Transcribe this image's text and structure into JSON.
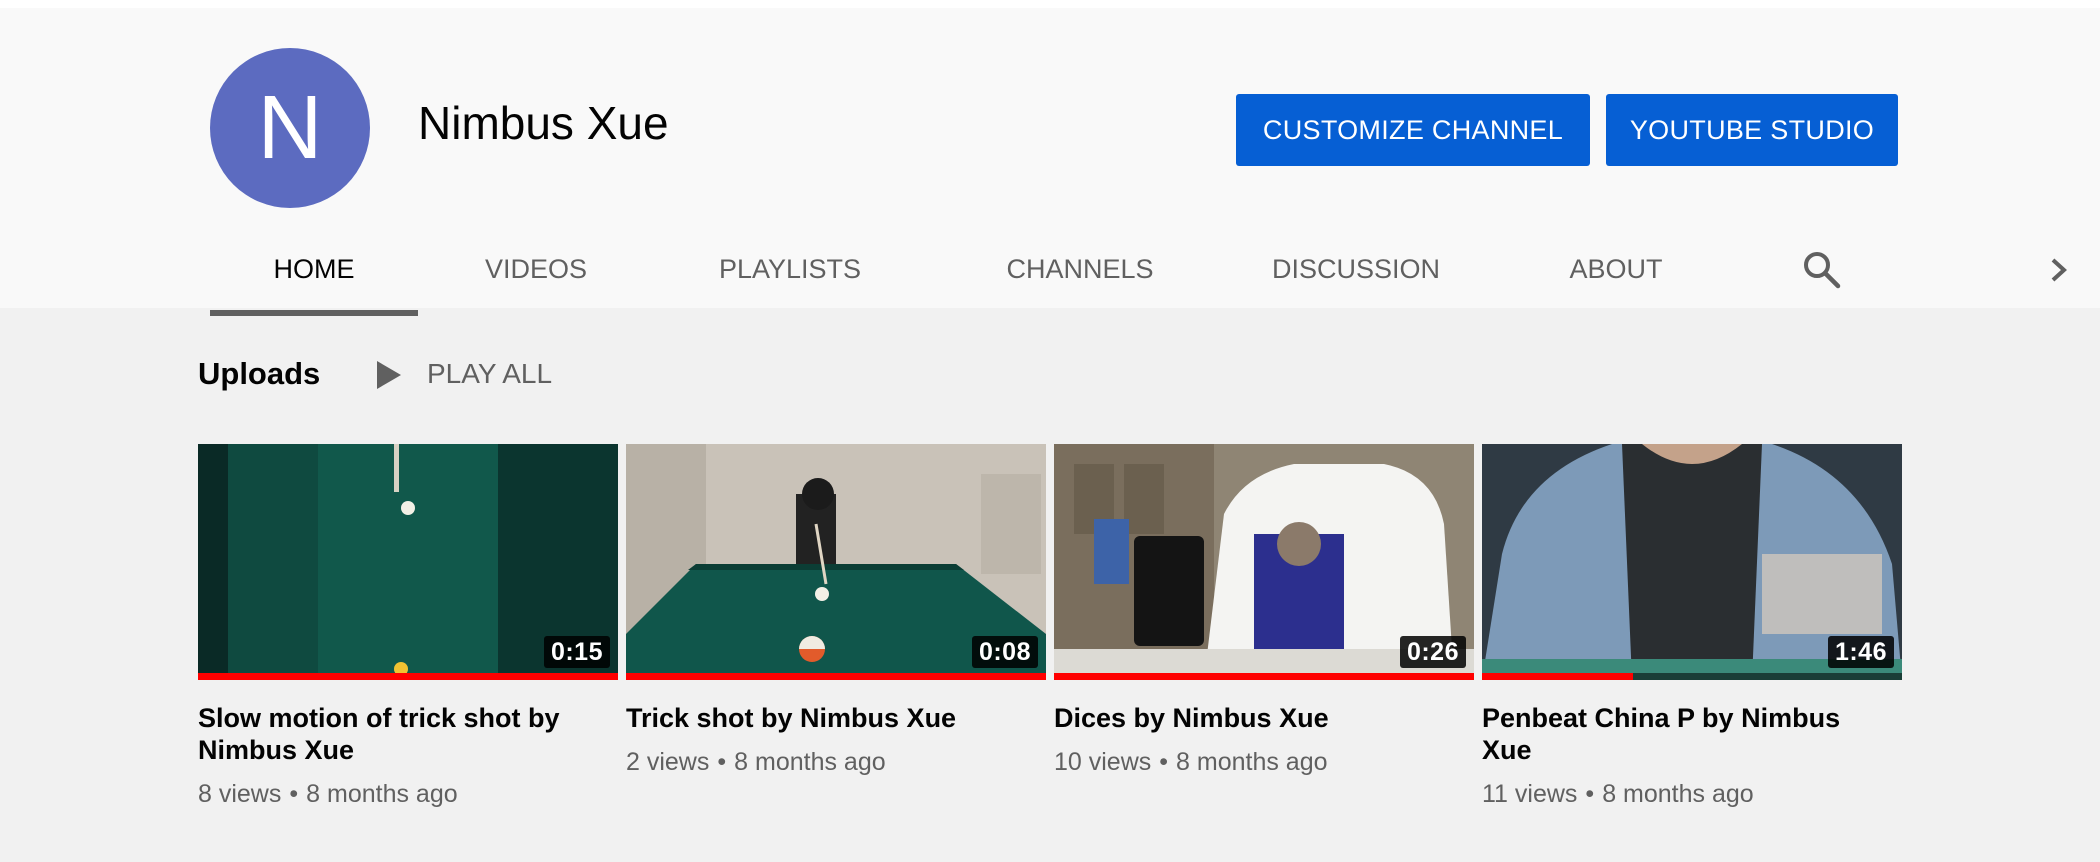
{
  "channel": {
    "avatar_letter": "N",
    "avatar_color": "#5c6bc0",
    "name": "Nimbus Xue",
    "customize_label": "CUSTOMIZE CHANNEL",
    "studio_label": "YOUTUBE STUDIO",
    "accent_color": "#065fd4"
  },
  "tabs": [
    {
      "label": "HOME",
      "active": true
    },
    {
      "label": "VIDEOS",
      "active": false
    },
    {
      "label": "PLAYLISTS",
      "active": false
    },
    {
      "label": "CHANNELS",
      "active": false
    },
    {
      "label": "DISCUSSION",
      "active": false
    },
    {
      "label": "ABOUT",
      "active": false
    }
  ],
  "tab_icons": {
    "search": "search-icon",
    "next": "chevron-right-icon"
  },
  "uploads": {
    "title": "Uploads",
    "play_all_label": "PLAY ALL",
    "play_icon": "play-icon"
  },
  "videos": [
    {
      "title": "Slow motion of trick shot by Nimbus Xue",
      "duration": "0:15",
      "views": "8 views",
      "age": "8 months ago",
      "watched_fraction": 1.0
    },
    {
      "title": "Trick shot by Nimbus Xue",
      "duration": "0:08",
      "views": "2 views",
      "age": "8 months ago",
      "watched_fraction": 1.0
    },
    {
      "title": "Dices by Nimbus Xue",
      "duration": "0:26",
      "views": "10 views",
      "age": "8 months ago",
      "watched_fraction": 1.0
    },
    {
      "title": "Penbeat China P by Nimbus Xue",
      "duration": "1:46",
      "views": "11 views",
      "age": "8 months ago",
      "watched_fraction": 0.36
    }
  ],
  "meta_separator": "•",
  "progress_color": "#ff0000"
}
